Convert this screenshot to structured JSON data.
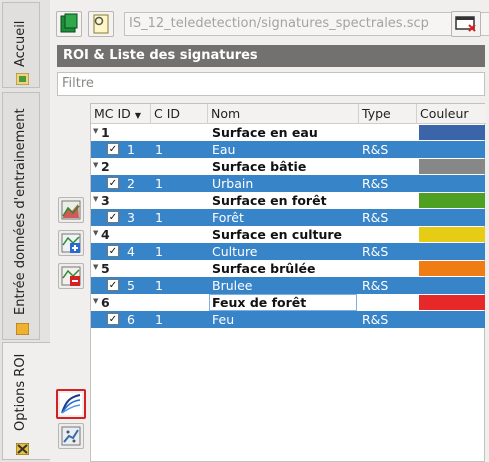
{
  "tabs": [
    {
      "label": "Accueil",
      "icon": "home-tab-icon"
    },
    {
      "label": "Entrée données d'entrainement",
      "icon": "training-input-tab-icon"
    },
    {
      "label": "Options ROI",
      "icon": "roi-options-tab-icon"
    }
  ],
  "toolbar": {
    "path_value": "IS_12_teledetection/signatures_spectrales.scp"
  },
  "section": {
    "title": "ROI & Liste des signatures"
  },
  "filter": {
    "placeholder": "Filtre"
  },
  "table": {
    "columns": [
      "MC ID",
      "C ID",
      "Nom",
      "Type",
      "Couleur"
    ],
    "rows": [
      {
        "kind": "parent",
        "mc_id": "1",
        "c_id": "",
        "name": "Surface en eau",
        "type": "",
        "color": "#3c64a8"
      },
      {
        "kind": "child",
        "mc_id": "1",
        "c_id": "1",
        "name": "Eau",
        "type": "R&S",
        "color": "#3884c8"
      },
      {
        "kind": "parent",
        "mc_id": "2",
        "c_id": "",
        "name": "Surface bâtie",
        "type": "",
        "color": "#878787"
      },
      {
        "kind": "child",
        "mc_id": "2",
        "c_id": "1",
        "name": "Urbain",
        "type": "R&S",
        "color": "#3884c8"
      },
      {
        "kind": "parent",
        "mc_id": "3",
        "c_id": "",
        "name": "Surface en forêt",
        "type": "",
        "color": "#4ea023"
      },
      {
        "kind": "child",
        "mc_id": "3",
        "c_id": "1",
        "name": "Forêt",
        "type": "R&S",
        "color": "#3884c8"
      },
      {
        "kind": "parent",
        "mc_id": "4",
        "c_id": "",
        "name": "Surface en culture",
        "type": "",
        "color": "#e6cc14"
      },
      {
        "kind": "child",
        "mc_id": "4",
        "c_id": "1",
        "name": "Culture",
        "type": "R&S",
        "color": "#3884c8"
      },
      {
        "kind": "parent",
        "mc_id": "5",
        "c_id": "",
        "name": "Surface brûlée",
        "type": "",
        "color": "#f07d14"
      },
      {
        "kind": "child",
        "mc_id": "5",
        "c_id": "1",
        "name": "Brulee",
        "type": "R&S",
        "color": "#3884c8"
      },
      {
        "kind": "parent",
        "mc_id": "6",
        "c_id": "",
        "name": "Feux de forêt",
        "type": "",
        "color": "#e62828"
      },
      {
        "kind": "child",
        "mc_id": "6",
        "c_id": "1",
        "name": "Feu",
        "type": "R&S",
        "color": "#3884c8"
      }
    ]
  },
  "colors": {
    "selection": "#3884c8",
    "header": "#727170",
    "highlight_border": "#d42020"
  }
}
